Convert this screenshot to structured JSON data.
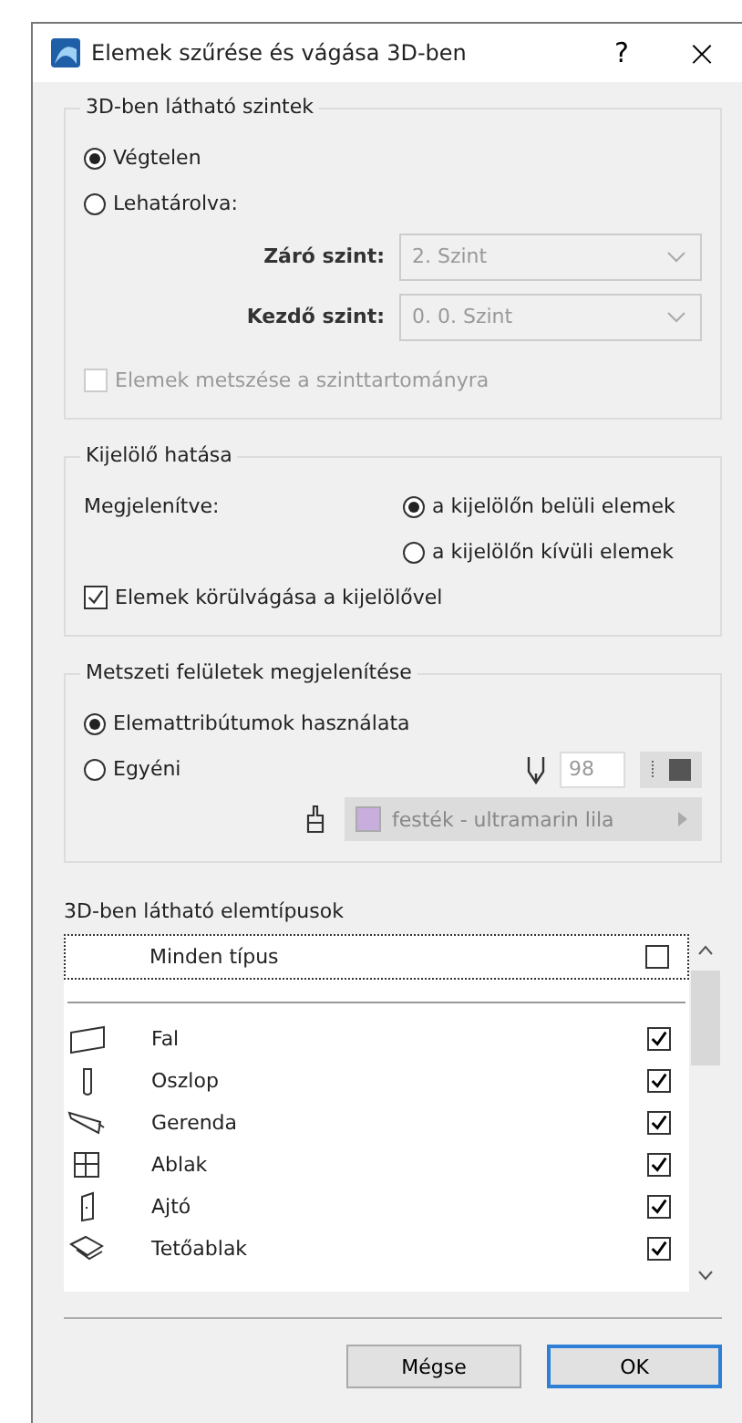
{
  "window": {
    "title": "Elemek szűrése és vágása 3D-ben",
    "help": "?",
    "close": "×"
  },
  "levels_group": {
    "title": "3D-ben látható szintek",
    "options": [
      {
        "label": "Végtelen",
        "selected": true
      },
      {
        "label": "Lehatárolva:",
        "selected": false
      }
    ],
    "fields": [
      {
        "label": "Záró szint:",
        "value": "2. Szint",
        "disabled": true
      },
      {
        "label": "Kezdő szint:",
        "value": "0. 0. Szint",
        "disabled": true
      }
    ],
    "cut_checkbox": {
      "label": "Elemek metszése a szinttartományra",
      "checked": false,
      "disabled": true
    }
  },
  "marquee_group": {
    "title": "Kijelölő hatása",
    "shown_label": "Megjelenítve:",
    "options": [
      {
        "label": "a kijelölőn belüli elemek",
        "selected": true
      },
      {
        "label": "a kijelölőn kívüli elemek",
        "selected": false
      }
    ],
    "trim_checkbox": {
      "label": "Elemek körülvágása a kijelölővel",
      "checked": true,
      "disabled": false
    }
  },
  "cut_surfaces_group": {
    "title": "Metszeti felületek megjelenítése",
    "options": [
      {
        "label": "Elemattribútumok használata",
        "selected": true
      },
      {
        "label": "Egyéni",
        "selected": false
      }
    ],
    "pen_value": "98",
    "material": {
      "label": "festék - ultramarin lila",
      "color": "#c8aedc"
    }
  },
  "element_types": {
    "title": "3D-ben látható elemtípusok",
    "all": {
      "label": "Minden típus",
      "checked": false
    },
    "items": [
      {
        "kind": "wall",
        "label": "Fal",
        "checked": true
      },
      {
        "kind": "column",
        "label": "Oszlop",
        "checked": true
      },
      {
        "kind": "beam",
        "label": "Gerenda",
        "checked": true
      },
      {
        "kind": "window",
        "label": "Ablak",
        "checked": true
      },
      {
        "kind": "door",
        "label": "Ajtó",
        "checked": true
      },
      {
        "kind": "skylight",
        "label": "Tetőablak",
        "checked": true
      }
    ]
  },
  "buttons": [
    {
      "label": "Mégse",
      "default": false
    },
    {
      "label": "OK",
      "default": true
    }
  ]
}
